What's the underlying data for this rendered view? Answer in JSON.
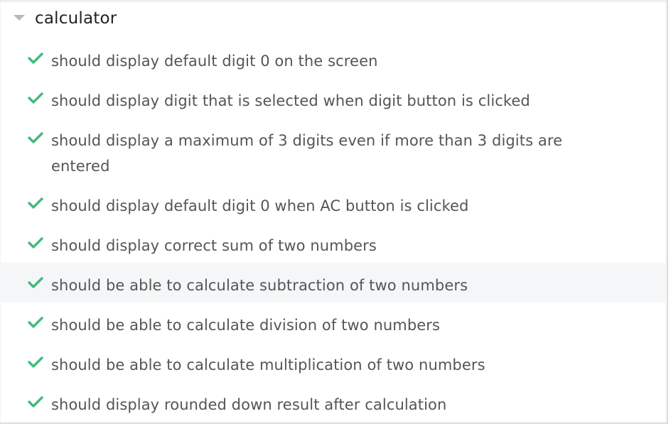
{
  "suite": {
    "title": "calculator",
    "expanded_icon": "caret-down-icon"
  },
  "status_icon": "check-icon",
  "colors": {
    "pass_green": "#44b87d",
    "text": "#555555",
    "title": "#222222",
    "hover_row": "#f5f6f7"
  },
  "tests": [
    {
      "label": "should display default digit 0 on the screen",
      "status": "passed"
    },
    {
      "label": "should display digit that is selected when digit button is clicked",
      "status": "passed"
    },
    {
      "label": "should display a maximum of 3 digits even if more than 3 digits are entered",
      "status": "passed"
    },
    {
      "label": "should display default digit 0 when AC button is clicked",
      "status": "passed"
    },
    {
      "label": "should display correct sum of two numbers",
      "status": "passed"
    },
    {
      "label": "should be able to calculate subtraction of two numbers",
      "status": "passed"
    },
    {
      "label": "should be able to calculate division of two numbers",
      "status": "passed"
    },
    {
      "label": "should be able to calculate multiplication of two numbers",
      "status": "passed"
    },
    {
      "label": "should display rounded down result after calculation",
      "status": "passed"
    }
  ]
}
